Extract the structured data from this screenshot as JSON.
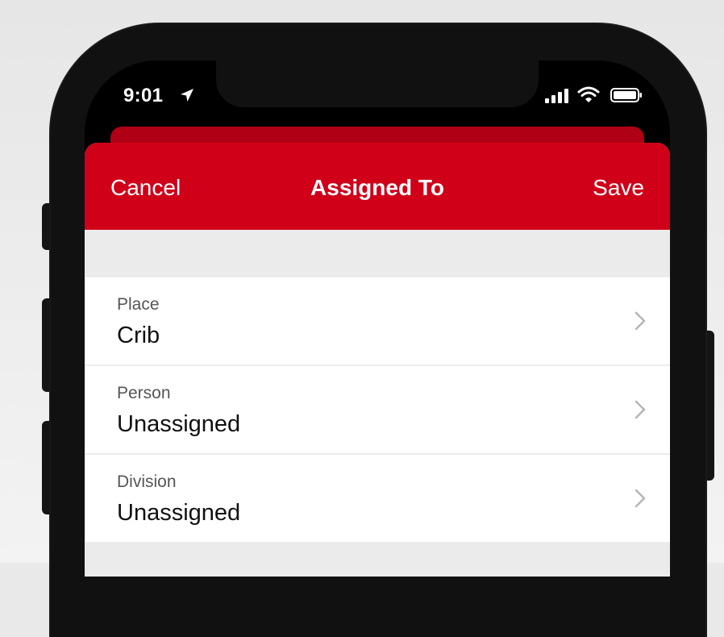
{
  "status_bar": {
    "time": "9:01",
    "icons": [
      "location-arrow-icon",
      "cellular-signal-icon",
      "wifi-icon",
      "battery-icon"
    ]
  },
  "navbar": {
    "cancel_label": "Cancel",
    "title": "Assigned To",
    "save_label": "Save",
    "background_color": "#d00019"
  },
  "rows": [
    {
      "label": "Place",
      "value": "Crib"
    },
    {
      "label": "Person",
      "value": "Unassigned"
    },
    {
      "label": "Division",
      "value": "Unassigned"
    }
  ],
  "icons": {
    "row_disclosure": "chevron-right-icon"
  }
}
